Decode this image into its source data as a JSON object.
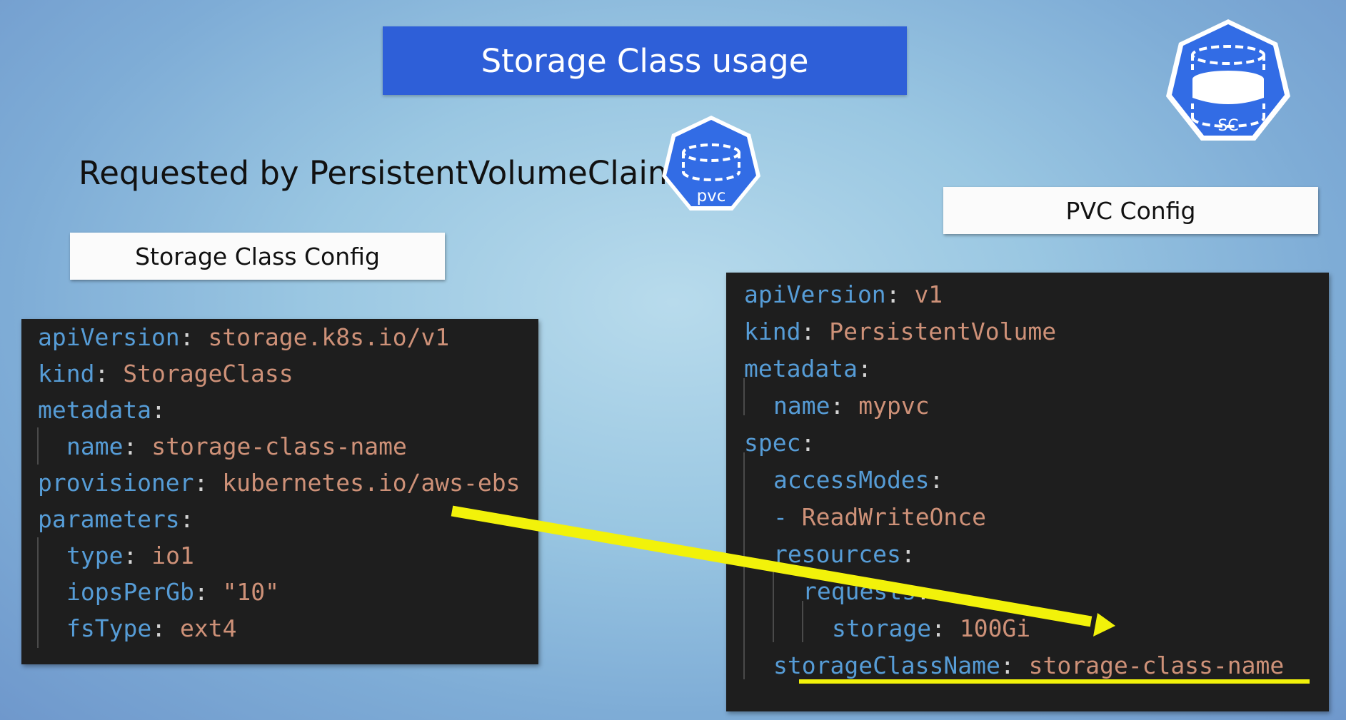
{
  "slide": {
    "title": "Storage Class usage",
    "subtitle": "Requested by PersistentVolumeClaim",
    "pvc_icon_label": "pvc",
    "sc_icon_label": "SC",
    "storage_class_config_label": "Storage Class Config",
    "pvc_config_label": "PVC Config"
  },
  "colors": {
    "title_bg": "#2e5fd8",
    "icon_blue": "#326ce5",
    "code_bg": "#1e1e1e",
    "yaml_key": "#569cd6",
    "yaml_value": "#ce9178",
    "yaml_punct": "#d4d4d4",
    "highlight": "#f2f20a"
  },
  "storage_class_yaml": [
    {
      "key": "apiVersion",
      "value": "storage.k8s.io/v1"
    },
    {
      "key": "kind",
      "value": "StorageClass"
    },
    {
      "key": "metadata",
      "value": ""
    },
    {
      "key": "name",
      "value": "storage-class-name"
    },
    {
      "key": "provisioner",
      "value": "kubernetes.io/aws-ebs"
    },
    {
      "key": "parameters",
      "value": ""
    },
    {
      "key": "type",
      "value": "io1"
    },
    {
      "key": "iopsPerGb",
      "value": "\"10\""
    },
    {
      "key": "fsType",
      "value": "ext4"
    }
  ],
  "pvc_yaml": [
    {
      "key": "apiVersion",
      "value": "v1"
    },
    {
      "key": "kind",
      "value": "PersistentVolume"
    },
    {
      "key": "metadata",
      "value": ""
    },
    {
      "key": "name",
      "value": "mypvc"
    },
    {
      "key": "spec",
      "value": ""
    },
    {
      "key": "accessModes",
      "value": ""
    },
    {
      "dash": "- ",
      "value": "ReadWriteOnce"
    },
    {
      "key": "resources",
      "value": ""
    },
    {
      "key": "requests",
      "value": ""
    },
    {
      "key": "storage",
      "value": "100Gi"
    },
    {
      "key": "storageClassName",
      "value": "storage-class-name"
    }
  ]
}
